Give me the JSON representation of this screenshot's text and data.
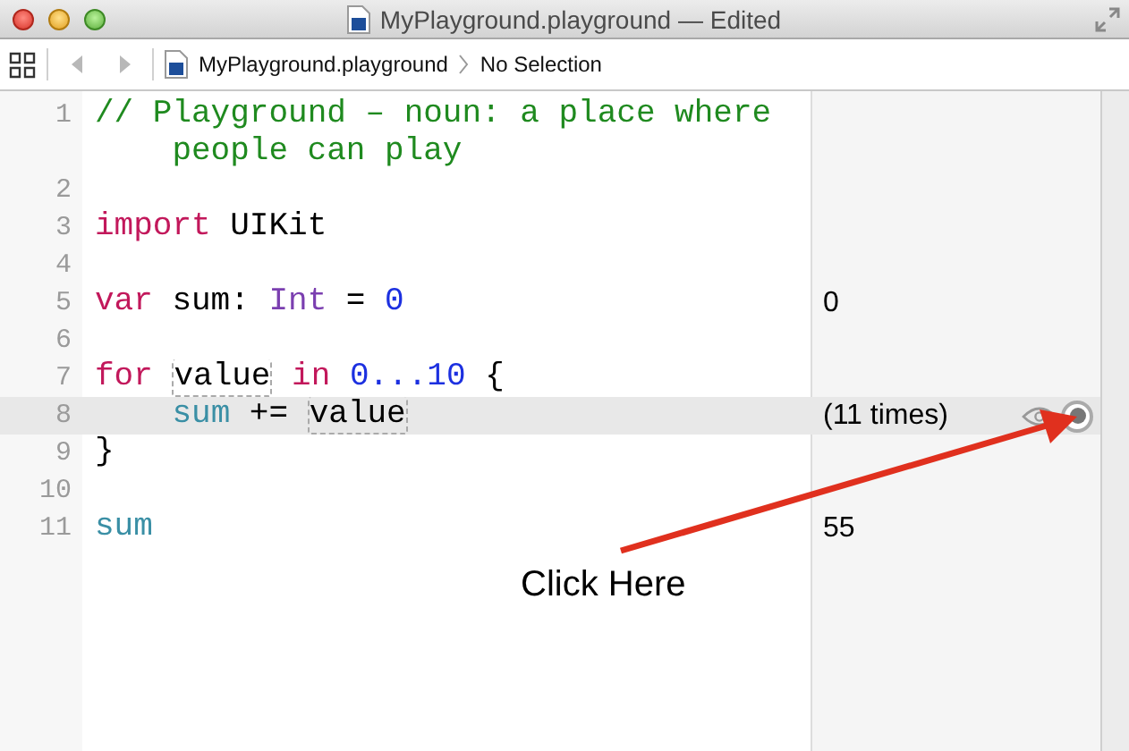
{
  "window": {
    "title": "MyPlayground.playground — Edited"
  },
  "jump_bar": {
    "back_disabled": true,
    "forward_disabled": true,
    "path": [
      "MyPlayground.playground",
      "No Selection"
    ]
  },
  "editor": {
    "lines": [
      {
        "number": "1",
        "highlighted": false,
        "tokens": [
          {
            "text": "// Playground – noun: a place where people can play",
            "kind": "comment"
          }
        ]
      },
      {
        "number": "2",
        "highlighted": false
      },
      {
        "number": "3",
        "highlighted": false,
        "tokens": [
          {
            "text": "import",
            "kind": "keyword"
          },
          {
            "text": " UIKit",
            "kind": "plain"
          }
        ]
      },
      {
        "number": "4",
        "highlighted": false
      },
      {
        "number": "5",
        "highlighted": false,
        "result": "0",
        "tokens": [
          {
            "text": "var",
            "kind": "keyword"
          },
          {
            "text": " sum: ",
            "kind": "plain"
          },
          {
            "text": "Int",
            "kind": "type"
          },
          {
            "text": " = ",
            "kind": "plain"
          },
          {
            "text": "0",
            "kind": "number"
          }
        ]
      },
      {
        "number": "6",
        "highlighted": false
      },
      {
        "number": "7",
        "highlighted": false,
        "tokens": [
          {
            "text": "for ",
            "kind": "keyword"
          },
          {
            "text": "value",
            "kind": "boxed"
          },
          {
            "text": " in ",
            "kind": "keyword"
          },
          {
            "text": "0...10",
            "kind": "number"
          },
          {
            "text": " {",
            "kind": "plain"
          }
        ]
      },
      {
        "number": "8",
        "highlighted": true,
        "result": "(11 times)",
        "tokens": [
          {
            "text": "    sum",
            "kind": "variable"
          },
          {
            "text": " += ",
            "kind": "plain"
          },
          {
            "text": "value",
            "kind": "boxed"
          }
        ]
      },
      {
        "number": "9",
        "highlighted": false,
        "tokens": [
          {
            "text": "}",
            "kind": "plain"
          }
        ]
      },
      {
        "number": "10",
        "highlighted": false
      },
      {
        "number": "11",
        "highlighted": false,
        "result": "55",
        "tokens": [
          {
            "text": "sum",
            "kind": "variable"
          }
        ]
      }
    ]
  },
  "annotation": {
    "label": "Click Here"
  }
}
